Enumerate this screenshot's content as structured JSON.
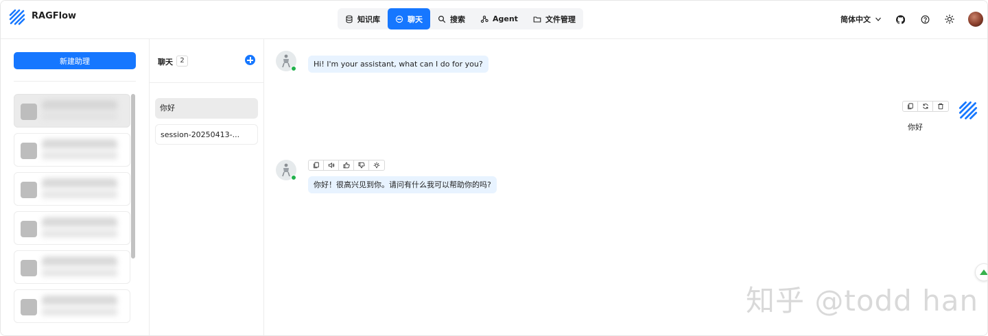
{
  "brand": {
    "name": "RAGFlow"
  },
  "nav": {
    "items": [
      {
        "label": "知识库",
        "icon": "database-icon"
      },
      {
        "label": "聊天",
        "icon": "chat-bubble-icon",
        "active": true
      },
      {
        "label": "搜索",
        "icon": "search-icon"
      },
      {
        "label": "Agent",
        "icon": "agent-graph-icon"
      },
      {
        "label": "文件管理",
        "icon": "folder-icon"
      }
    ]
  },
  "header_tools": {
    "language": "简体中文",
    "icons": [
      "github-icon",
      "help-icon",
      "theme-sun-icon"
    ]
  },
  "assistants": {
    "new_button_label": "新建助理",
    "count_visible": 6,
    "note_blurred": true
  },
  "sessions": {
    "title": "聊天",
    "count": "2",
    "items": [
      {
        "label": "你好",
        "active": true
      },
      {
        "label": "session-20250413-..."
      }
    ]
  },
  "chat": {
    "greeting": "Hi! I'm your assistant, what can I do for you?",
    "user_message": "你好",
    "reply": "你好！很高兴见到你。请问有什么我可以帮助你的吗?",
    "user_actions": [
      "copy-icon",
      "regenerate-icon",
      "delete-icon"
    ],
    "bot_actions": [
      "copy-icon",
      "speaker-icon",
      "thumbs-up-icon",
      "thumbs-down-icon",
      "lightbulb-icon"
    ]
  },
  "watermark": "知乎 @todd han",
  "colors": {
    "accent": "#1677ff",
    "bubble": "#e8f3ff",
    "online": "#22b14c"
  }
}
